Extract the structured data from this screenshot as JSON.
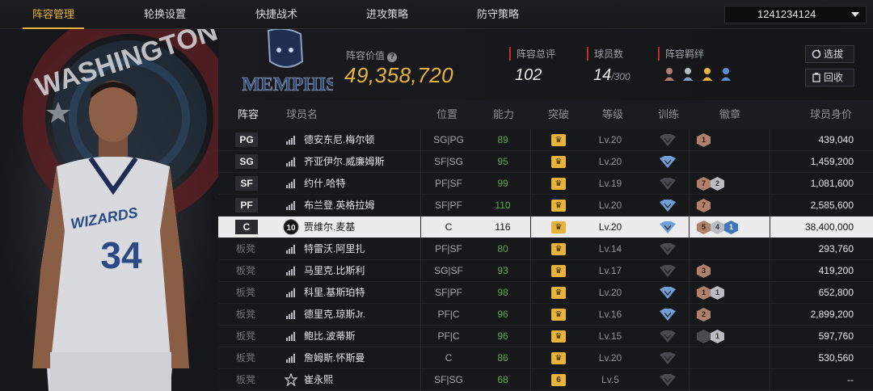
{
  "tabs": [
    {
      "label": "阵容管理",
      "active": true
    },
    {
      "label": "轮换设置",
      "active": false
    },
    {
      "label": "快捷战术",
      "active": false
    },
    {
      "label": "进攻策略",
      "active": false
    },
    {
      "label": "防守策略",
      "active": false
    }
  ],
  "account_id": "1241234124",
  "header": {
    "lineup_value_label": "阵容价值",
    "lineup_value": "49,358,720",
    "rating_label": "阵容总评",
    "rating": "102",
    "player_count_label": "球员数",
    "player_count": "14",
    "player_count_max": "/300",
    "bond_label": "阵容羁绊",
    "select_button": "选拔",
    "recycle_button": "回收"
  },
  "columns": [
    "阵容",
    "球员名",
    "位置",
    "能力",
    "突破",
    "等级",
    "训练",
    "徽章",
    "球员身价"
  ],
  "rows": [
    {
      "slot": "PG",
      "name": "德安东尼.梅尔顿",
      "position": "SG|PG",
      "ability": "89",
      "level": "Lv.20",
      "worth": "439,040",
      "starter": true,
      "train": "dark",
      "badges": [
        {
          "t": "bronze",
          "n": "1"
        }
      ]
    },
    {
      "slot": "SG",
      "name": "齐亚伊尔.威廉姆斯",
      "position": "SF|SG",
      "ability": "95",
      "level": "Lv.20",
      "worth": "1,459,200",
      "starter": true,
      "train": "blue",
      "badges": []
    },
    {
      "slot": "SF",
      "name": "约什.哈特",
      "position": "PF|SF",
      "ability": "99",
      "level": "Lv.19",
      "worth": "1,081,600",
      "starter": true,
      "train": "dark",
      "badges": [
        {
          "t": "bronze",
          "n": "7"
        },
        {
          "t": "silver",
          "n": "2"
        }
      ]
    },
    {
      "slot": "PF",
      "name": "布兰登.英格拉姆",
      "position": "SF|PF",
      "ability": "110",
      "level": "Lv.20",
      "worth": "2,585,600",
      "starter": true,
      "train": "blue",
      "badges": [
        {
          "t": "bronze",
          "n": "7"
        }
      ]
    },
    {
      "slot": "C",
      "name": "贾维尔.麦基",
      "position": "C",
      "ability": "116",
      "level": "Lv.20",
      "worth": "38,400,000",
      "starter": true,
      "selected": true,
      "train": "blue",
      "badges": [
        {
          "t": "bronze",
          "n": "5"
        },
        {
          "t": "silver",
          "n": "4"
        },
        {
          "t": "blue",
          "n": "1"
        }
      ]
    },
    {
      "slot": "板凳",
      "name": "特雷沃.阿里扎",
      "position": "PF|SF",
      "ability": "80",
      "level": "Lv.14",
      "worth": "293,760",
      "starter": false,
      "train": "dark",
      "badges": []
    },
    {
      "slot": "板凳",
      "name": "马里克.比斯利",
      "position": "SG|SF",
      "ability": "93",
      "level": "Lv.17",
      "worth": "419,200",
      "starter": false,
      "train": "dark",
      "badges": [
        {
          "t": "bronze",
          "n": "3"
        }
      ]
    },
    {
      "slot": "板凳",
      "name": "科里.基斯珀特",
      "position": "SF|PF",
      "ability": "98",
      "level": "Lv.20",
      "worth": "652,800",
      "starter": false,
      "train": "blue",
      "badges": [
        {
          "t": "bronze",
          "n": "1"
        },
        {
          "t": "silver",
          "n": "1"
        }
      ]
    },
    {
      "slot": "板凳",
      "name": "德里克.琼斯Jr.",
      "position": "PF|C",
      "ability": "96",
      "level": "Lv.16",
      "worth": "2,899,200",
      "starter": false,
      "train": "blue",
      "badges": [
        {
          "t": "bronze",
          "n": "2"
        }
      ]
    },
    {
      "slot": "板凳",
      "name": "鲍比.波蒂斯",
      "position": "PF|C",
      "ability": "96",
      "level": "Lv.15",
      "worth": "597,760",
      "starter": false,
      "train": "dark",
      "badges": [
        {
          "t": "dark",
          "n": ""
        },
        {
          "t": "silver",
          "n": "1"
        }
      ]
    },
    {
      "slot": "板凳",
      "name": "詹姆斯.怀斯曼",
      "position": "C",
      "ability": "86",
      "level": "Lv.20",
      "worth": "530,560",
      "starter": false,
      "train": "dark",
      "badges": []
    },
    {
      "slot": "板凳",
      "name": "崔永熙",
      "position": "SF|SG",
      "ability": "68",
      "level": "Lv.5",
      "worth": "--",
      "starter": false,
      "train": "dark",
      "badges": [],
      "breakthrough_num": "6",
      "star_icon": true
    }
  ],
  "selected_badge_number": "10",
  "player_art": {
    "jersey_text": "WIZARDS",
    "jersey_number": "34",
    "arena_text": "WASHINGTON",
    "team_logo_text": "MEMPHIS"
  },
  "colors": {
    "accent": "#e7b33b",
    "ability_green": "#58a84c",
    "red_marker": "#c0282d",
    "badge_blue": "#3e78b6"
  }
}
